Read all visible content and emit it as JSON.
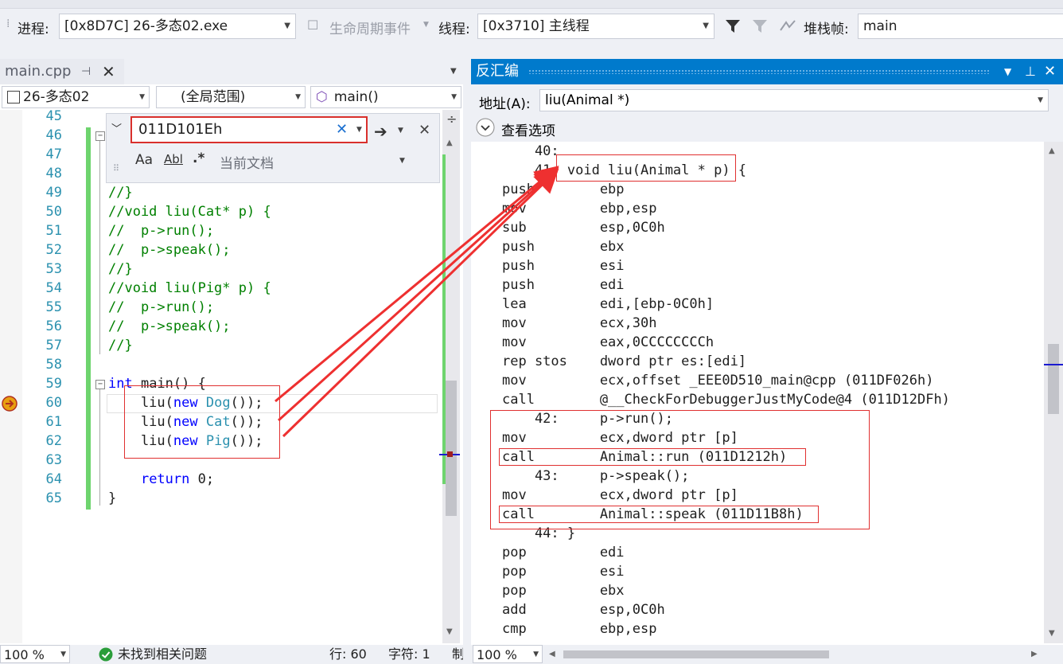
{
  "toolbar": {
    "process_label": "进程:",
    "process_value": "[0x8D7C] 26-多态02.exe",
    "lifecycle_label": "生命周期事件",
    "thread_label": "线程:",
    "thread_value": "[0x3710] 主线程",
    "stack_label": "堆栈帧:",
    "stack_value": "main"
  },
  "editor": {
    "tab_title": "main.cpp",
    "project_combo": "26-多态02",
    "scope_combo": "(全局范围)",
    "member_combo": "main()",
    "find_value": "011D101Eh",
    "find_scope": "当前文档",
    "find_opt_case": "Aa",
    "find_opt_word": "Abl",
    "find_opt_regex": ".*",
    "line_numbers": [
      "45",
      "46",
      "47",
      "48",
      "49",
      "50",
      "51",
      "52",
      "53",
      "54",
      "55",
      "56",
      "57",
      "58",
      "59",
      "60",
      "61",
      "62",
      "63",
      "64",
      "65"
    ],
    "zoom": "100 %",
    "issues": "未找到相关问题",
    "row": "行: 60",
    "col": "字符: 1",
    "trunc": "制"
  },
  "disassembly": {
    "title": "反汇编",
    "address_label": "地址(A):",
    "address_value": "liu(Animal *)",
    "view_options": "查看选项",
    "zoom": "100 %"
  },
  "colors": {
    "accent": "#007acc",
    "comment": "#008000",
    "keyword": "#0000ff",
    "type": "#2b91af",
    "annotation": "#e03030"
  }
}
